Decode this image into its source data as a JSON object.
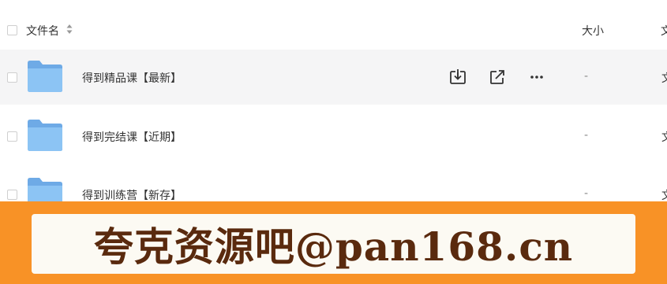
{
  "header": {
    "name_label": "文件名",
    "size_label": "大小",
    "extra_label": "文"
  },
  "rows": [
    {
      "name": "得到精品课【最新】",
      "size": "-",
      "extra": "文"
    },
    {
      "name": "得到完结课【近期】",
      "size": "-",
      "extra": "文"
    },
    {
      "name": "得到训练营【新存】",
      "size": "-",
      "extra": "文"
    }
  ],
  "banner": {
    "text": "夸克资源吧@pan168.cn"
  },
  "colors": {
    "folder": "#7fb8ee",
    "banner_bg": "#f89226",
    "banner_text": "#5a2a0e",
    "row_hover": "#f5f5f6"
  },
  "icons": {
    "download": "download-icon",
    "share": "share-icon",
    "more": "more-icon",
    "folder": "folder-icon",
    "sort": "sort-icon"
  }
}
